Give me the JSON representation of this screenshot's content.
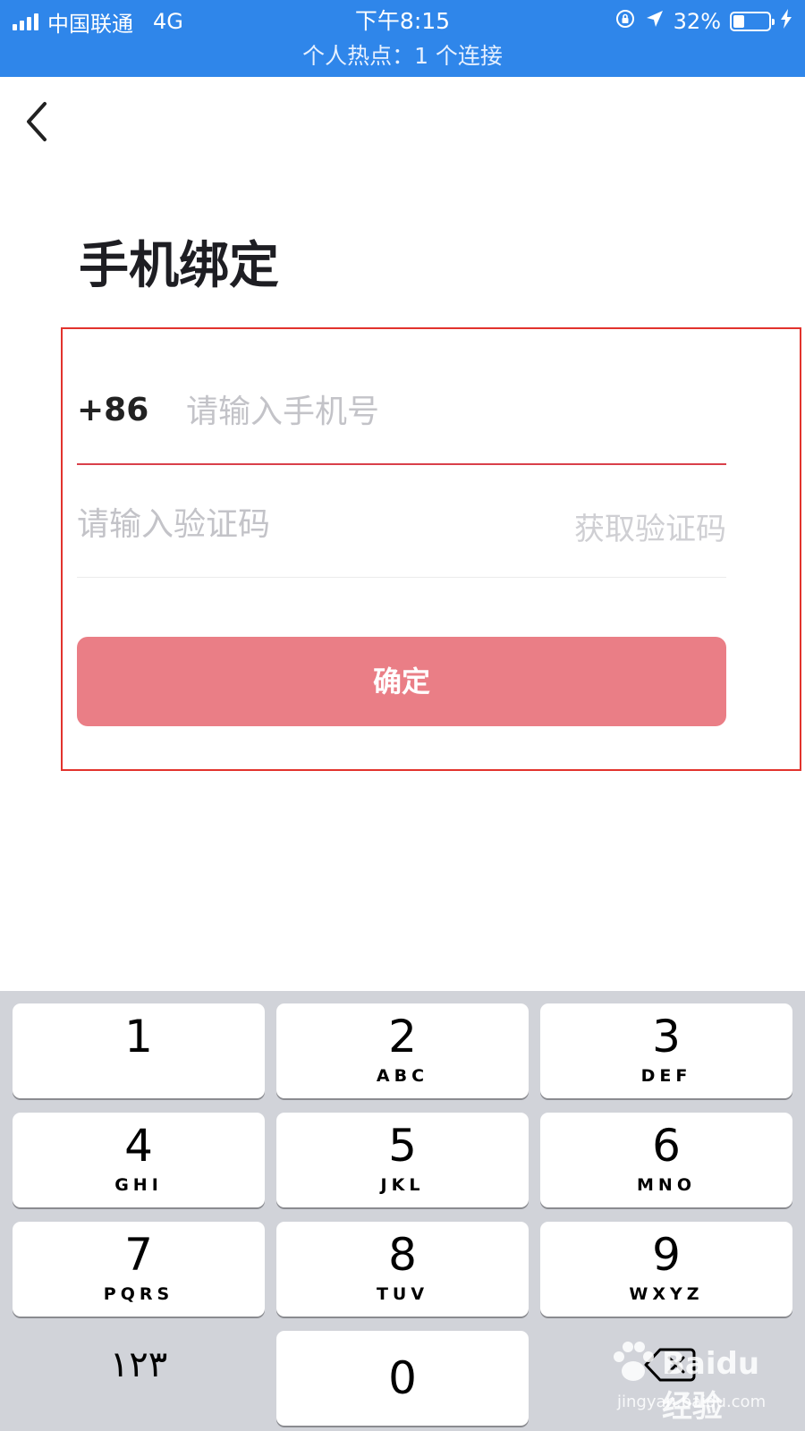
{
  "status_bar": {
    "carrier": "中国联通",
    "network": "4G",
    "time": "下午8:15",
    "battery_percent": "32%",
    "battery_level": 0.32,
    "hotspot_text": "个人热点：1 个连接",
    "bg_color": "#2f86ea"
  },
  "nav": {
    "back_icon": "chevron-left-icon"
  },
  "page": {
    "title": "手机绑定"
  },
  "form": {
    "country_code": "+86",
    "phone_placeholder": "请输入手机号",
    "phone_value": "",
    "code_placeholder": "请输入验证码",
    "code_value": "",
    "get_code_label": "获取验证码",
    "confirm_label": "确定",
    "confirm_color": "#ea7e86",
    "highlight_color": "#e2332d"
  },
  "keyboard": {
    "keys": [
      {
        "num": "1",
        "letters": ""
      },
      {
        "num": "2",
        "letters": "ABC"
      },
      {
        "num": "3",
        "letters": "DEF"
      },
      {
        "num": "4",
        "letters": "GHI"
      },
      {
        "num": "5",
        "letters": "JKL"
      },
      {
        "num": "6",
        "letters": "MNO"
      },
      {
        "num": "7",
        "letters": "PQRS"
      },
      {
        "num": "8",
        "letters": "TUV"
      },
      {
        "num": "9",
        "letters": "WXYZ"
      },
      {
        "num": "0",
        "letters": ""
      }
    ],
    "symbols_label": "١٢٣",
    "delete_icon": "backspace-icon"
  },
  "watermark": {
    "main": "Baidu经验",
    "sub": "jingyan.baidu.com"
  }
}
